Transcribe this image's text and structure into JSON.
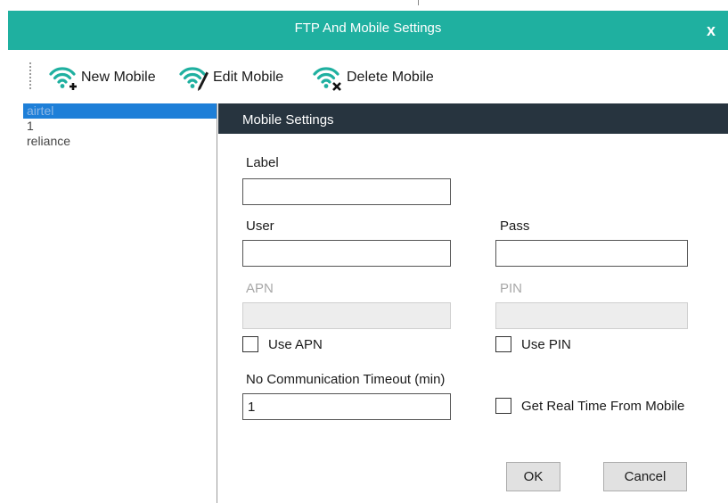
{
  "window": {
    "title": "FTP And Mobile Settings",
    "close_label": "x",
    "accent_color": "#1fb0a0"
  },
  "toolbar": {
    "new_label": "New Mobile",
    "edit_label": "Edit Mobile",
    "delete_label": "Delete Mobile",
    "icons": [
      "wifi-add-icon",
      "wifi-edit-icon",
      "wifi-delete-icon"
    ]
  },
  "mobile_list": {
    "items": [
      "airtel",
      "1",
      "reliance"
    ],
    "selected": "airtel",
    "selection_color": "#1e7fd8"
  },
  "settings": {
    "header": "Mobile Settings",
    "label_label": "Label",
    "label_value": "",
    "user_label": "User",
    "user_value": "",
    "pass_label": "Pass",
    "pass_value": "",
    "apn_label": "APN",
    "apn_value": "",
    "pin_label": "PIN",
    "pin_value": "",
    "use_apn_label": "Use APN",
    "use_apn_checked": false,
    "use_pin_label": "Use PIN",
    "use_pin_checked": false,
    "timeout_label": "No Communication Timeout (min)",
    "timeout_value": "1",
    "real_time_label": "Get Real Time From Mobile",
    "real_time_checked": false,
    "ok_label": "OK",
    "cancel_label": "Cancel"
  }
}
